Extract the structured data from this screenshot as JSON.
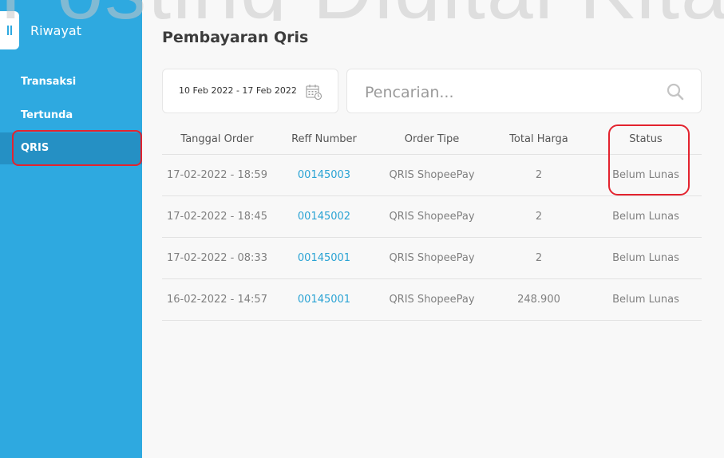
{
  "watermark": "Posting Digital Kita",
  "sidebar": {
    "title": "Riwayat",
    "items": [
      {
        "label": "Transaksi"
      },
      {
        "label": "Tertunda"
      },
      {
        "label": "QRIS"
      }
    ]
  },
  "main": {
    "title": "Pembayaran Qris",
    "date_range": "10 Feb 2022 - 17 Feb 2022",
    "search": {
      "placeholder": "Pencarian..."
    },
    "table": {
      "headers": [
        "Tanggal Order",
        "Reff Number",
        "Order Tipe",
        "Total Harga",
        "Status"
      ],
      "rows": [
        {
          "tanggal": "17-02-2022 - 18:59",
          "reff": "00145003",
          "tipe": "QRIS ShopeePay",
          "harga": "2",
          "status": "Belum Lunas"
        },
        {
          "tanggal": "17-02-2022 - 18:45",
          "reff": "00145002",
          "tipe": "QRIS ShopeePay",
          "harga": "2",
          "status": "Belum Lunas"
        },
        {
          "tanggal": "17-02-2022 - 08:33",
          "reff": "00145001",
          "tipe": "QRIS ShopeePay",
          "harga": "2",
          "status": "Belum Lunas"
        },
        {
          "tanggal": "16-02-2022 - 14:57",
          "reff": "00145001",
          "tipe": "QRIS ShopeePay",
          "harga": "248.900",
          "status": "Belum Lunas"
        }
      ]
    }
  },
  "colors": {
    "sidebar": "#2ea9e0",
    "sidebar_active": "#2590c4",
    "highlight": "#e3232e",
    "link": "#2aa3d4"
  },
  "icons": {
    "collapse": "collapse-icon",
    "calendar": "calendar-icon",
    "search": "search-icon"
  }
}
